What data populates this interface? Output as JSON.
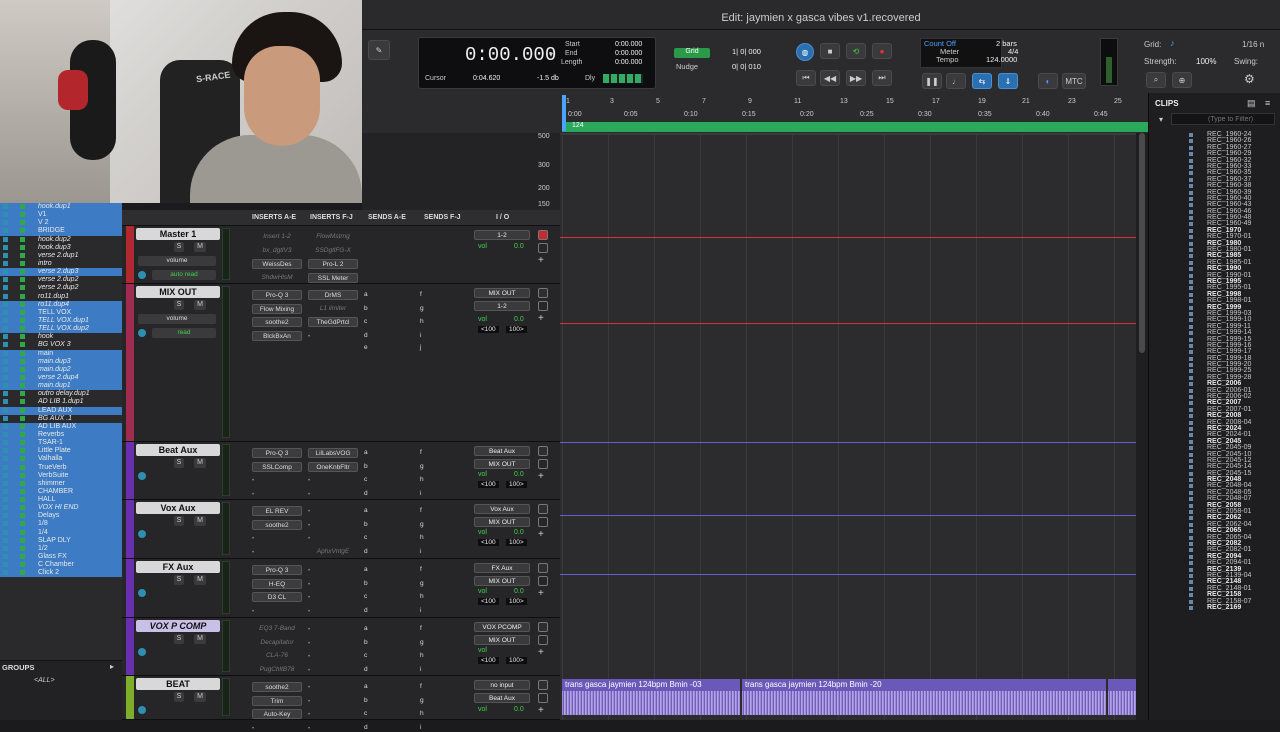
{
  "window": {
    "title": "Edit: jaymien x gasca vibes v1.recovered"
  },
  "webcam": {
    "chair_text": "S-RACE"
  },
  "transport": {
    "counter": "0:00.000",
    "start_label": "Start",
    "end_label": "End",
    "length_label": "Length",
    "start": "0:00.000",
    "end": "0:00.000",
    "length": "0:00.000",
    "cursor_label": "Cursor",
    "cursor": "0:04.620",
    "cursor_db": "-1.5 db",
    "dly_label": "Dly",
    "grid_label": "Grid",
    "grid_value": "1| 0| 000",
    "nudge_label": "Nudge",
    "nudge_value": "0| 0| 010",
    "count_off": "Count Off",
    "count_bars": "2 bars",
    "meter_label": "Meter",
    "meter_value": "4/4",
    "tempo_label": "Tempo",
    "tempo_value": "124.0000",
    "mtc": "MTC",
    "grid_right_label": "Grid:",
    "grid_right_value": "1/16 n",
    "strength_label": "Strength:",
    "strength_value": "100%",
    "swing_label": "Swing:"
  },
  "ruler": {
    "bars": [
      "1",
      "3",
      "5",
      "7",
      "9",
      "11",
      "13",
      "15",
      "17",
      "19",
      "21",
      "23",
      "25"
    ],
    "times": [
      "0:00",
      "0:05",
      "0:10",
      "0:15",
      "0:20",
      "0:25",
      "0:30",
      "0:35",
      "0:40",
      "0:45"
    ],
    "marker": "124",
    "tempo_scale": [
      "500",
      "300",
      "200",
      "150"
    ]
  },
  "clips": {
    "header": "CLIPS",
    "filter_placeholder": "(Type to Filter)",
    "items": [
      {
        "n": "REC_1960-24"
      },
      {
        "n": "REC_1960-26"
      },
      {
        "n": "REC_1960-27"
      },
      {
        "n": "REC_1960-29"
      },
      {
        "n": "REC_1960-32"
      },
      {
        "n": "REC_1960-33"
      },
      {
        "n": "REC_1960-35"
      },
      {
        "n": "REC_1960-37"
      },
      {
        "n": "REC_1960-38"
      },
      {
        "n": "REC_1960-39"
      },
      {
        "n": "REC_1960-40"
      },
      {
        "n": "REC_1960-43"
      },
      {
        "n": "REC_1960-46"
      },
      {
        "n": "REC_1960-48"
      },
      {
        "n": "REC_1960-49"
      },
      {
        "n": "REC_1970",
        "b": true
      },
      {
        "n": "REC_1970-01"
      },
      {
        "n": "REC_1980",
        "b": true
      },
      {
        "n": "REC_1980-01"
      },
      {
        "n": "REC_1985",
        "b": true
      },
      {
        "n": "REC_1985-01"
      },
      {
        "n": "REC_1990",
        "b": true
      },
      {
        "n": "REC_1990-01"
      },
      {
        "n": "REC_1995",
        "b": true
      },
      {
        "n": "REC_1995-01"
      },
      {
        "n": "REC_1998",
        "b": true
      },
      {
        "n": "REC_1998-01"
      },
      {
        "n": "REC_1999",
        "b": true
      },
      {
        "n": "REC_1999-03"
      },
      {
        "n": "REC_1999-10"
      },
      {
        "n": "REC_1999-11"
      },
      {
        "n": "REC_1999-14"
      },
      {
        "n": "REC_1999-15"
      },
      {
        "n": "REC_1999-16"
      },
      {
        "n": "REC_1999-17"
      },
      {
        "n": "REC_1999-18"
      },
      {
        "n": "REC_1999-20"
      },
      {
        "n": "REC_1999-25"
      },
      {
        "n": "REC_1999-28"
      },
      {
        "n": "REC_2006",
        "b": true
      },
      {
        "n": "REC_2006-01"
      },
      {
        "n": "REC_2006-02"
      },
      {
        "n": "REC_2007",
        "b": true
      },
      {
        "n": "REC_2007-01"
      },
      {
        "n": "REC_2008",
        "b": true
      },
      {
        "n": "REC_2008-04"
      },
      {
        "n": "REC_2024",
        "b": true
      },
      {
        "n": "REC_2024-01"
      },
      {
        "n": "REC_2045",
        "b": true
      },
      {
        "n": "REC_2045-09"
      },
      {
        "n": "REC_2045-10"
      },
      {
        "n": "REC_2045-12"
      },
      {
        "n": "REC_2045-14"
      },
      {
        "n": "REC_2045-15"
      },
      {
        "n": "REC_2048",
        "b": true
      },
      {
        "n": "REC_2048-04"
      },
      {
        "n": "REC_2048-05"
      },
      {
        "n": "REC_2048-07"
      },
      {
        "n": "REC_2058",
        "b": true
      },
      {
        "n": "REC_2058-01"
      },
      {
        "n": "REC_2062",
        "b": true
      },
      {
        "n": "REC_2062-04"
      },
      {
        "n": "REC_2065",
        "b": true
      },
      {
        "n": "REC_2065-04"
      },
      {
        "n": "REC_2082",
        "b": true
      },
      {
        "n": "REC_2082-01"
      },
      {
        "n": "REC_2094",
        "b": true
      },
      {
        "n": "REC_2094-01"
      },
      {
        "n": "REC_2139",
        "b": true
      },
      {
        "n": "REC_2139-04"
      },
      {
        "n": "REC_2148",
        "b": true
      },
      {
        "n": "REC_2148-01"
      },
      {
        "n": "REC_2158",
        "b": true
      },
      {
        "n": "REC_2158-07"
      },
      {
        "n": "REC_2169",
        "b": true
      }
    ]
  },
  "tracks": {
    "items": [
      {
        "n": "hook.dup1",
        "sel": true,
        "it": true
      },
      {
        "n": "V1",
        "sel": true
      },
      {
        "n": "V 2",
        "sel": true
      },
      {
        "n": "BRIDGE",
        "sel": true
      },
      {
        "n": "hook.dup2",
        "it": true
      },
      {
        "n": "hook.dup3",
        "it": true
      },
      {
        "n": "verse 2.dup1",
        "it": true
      },
      {
        "n": "intro",
        "it": true
      },
      {
        "n": "verse 2.dup3",
        "sel": true,
        "it": true
      },
      {
        "n": "verse 2.dup2",
        "it": true
      },
      {
        "n": "verse 2.dup2",
        "it": true
      },
      {
        "n": "ro11.dup1",
        "it": true
      },
      {
        "n": "ro11.dup4",
        "sel": true,
        "it": true
      },
      {
        "n": "TELL VOX",
        "sel": true
      },
      {
        "n": "TELL VOX.dup1",
        "sel": true,
        "it": true
      },
      {
        "n": "TELL VOX.dup2",
        "sel": true,
        "it": true
      },
      {
        "n": "hook",
        "it": true
      },
      {
        "n": "BG VOX 3",
        "it": true
      },
      {
        "n": "main",
        "sel": true
      },
      {
        "n": "main.dup3",
        "sel": true,
        "it": true
      },
      {
        "n": "main.dup2",
        "sel": true,
        "it": true
      },
      {
        "n": "verse 2.dup4",
        "sel": true,
        "it": true
      },
      {
        "n": "main.dup1",
        "sel": true,
        "it": true
      },
      {
        "n": "outro delay.dup1",
        "it": true
      },
      {
        "n": "AD LIB 1.dup1",
        "it": true
      },
      {
        "n": "LEAD AUX",
        "sel": true
      },
      {
        "n": "BG AUX .1",
        "it": true
      },
      {
        "n": "AD LIB AUX",
        "sel": true
      },
      {
        "n": "Reverbs",
        "sel": true
      },
      {
        "n": "TSAR-1",
        "sel": true
      },
      {
        "n": "Little Plate",
        "sel": true
      },
      {
        "n": "Valhalla",
        "sel": true
      },
      {
        "n": "TrueVerb",
        "sel": true
      },
      {
        "n": "VerbSuite",
        "sel": true
      },
      {
        "n": "shimmer",
        "sel": true
      },
      {
        "n": "CHAMBER",
        "sel": true
      },
      {
        "n": "HALL",
        "sel": true
      },
      {
        "n": "VOX HI END",
        "sel": true,
        "it": true
      },
      {
        "n": "Delays",
        "sel": true
      },
      {
        "n": "1/8",
        "sel": true
      },
      {
        "n": "1/4",
        "sel": true
      },
      {
        "n": "SLAP DLY",
        "sel": true
      },
      {
        "n": "1/2",
        "sel": true
      },
      {
        "n": "Glass FX",
        "sel": true
      },
      {
        "n": "C Chamber",
        "sel": true
      },
      {
        "n": "Click 2",
        "sel": true
      }
    ],
    "groups_label": "GROUPS",
    "groups_all": "<ALL>"
  },
  "mixer": {
    "headers": {
      "inserts_ae": "INSERTS A-E",
      "inserts_fj": "INSERTS F-J",
      "sends_ae": "SENDS A-E",
      "sends_fj": "SENDS F-J",
      "io": "I / O"
    },
    "strips": [
      {
        "name": "Master 1",
        "auto1": "volume",
        "auto2": "auto read",
        "a": [
          "Insert 1-2",
          "bx_dgtlV3",
          "WeissDes",
          "ShdwHlsM"
        ],
        "b": [
          "FlowMstrng",
          "SSDgtlFG-X",
          "Pro-L 2",
          "SSL Meter"
        ],
        "io1": "1-2",
        "io2": "",
        "vol": "vol",
        "vol_v": "0.0",
        "pan_l": "",
        "pan_r": "",
        "color": "#b02830"
      },
      {
        "name": "MIX OUT",
        "auto1": "volume",
        "auto2": "read",
        "a": [
          "Pro-Q 3",
          "Flow Mixing",
          "soothe2",
          "BlckBxAn"
        ],
        "b": [
          "DrMS",
          "L1 limiter",
          "TheGdPrtcl",
          ""
        ],
        "io1": "MIX OUT",
        "io2": "1-2",
        "vol": "vol",
        "vol_v": "0.0",
        "pan_l": "<100",
        "pan_r": "100>",
        "color": "#a02a50"
      },
      {
        "name": "Beat Aux",
        "auto1": "",
        "auto2": "",
        "a": [
          "Pro-Q 3",
          "SSLComp",
          "",
          ""
        ],
        "b": [
          "LilLabsVOG",
          "OneKnbFltr",
          "",
          ""
        ],
        "io1": "Beat Aux",
        "io2": "MIX OUT",
        "vol": "vol",
        "vol_v": "0.0",
        "pan_l": "<100",
        "pan_r": "100>",
        "color": "#6a2fb0"
      },
      {
        "name": "Vox Aux",
        "auto1": "",
        "auto2": "",
        "a": [
          "EL REV",
          "soothe2",
          "",
          ""
        ],
        "b": [
          "",
          "",
          "",
          "AphxVntgE"
        ],
        "io1": "Vox Aux",
        "io2": "MIX OUT",
        "vol": "vol",
        "vol_v": "0.0",
        "pan_l": "<100",
        "pan_r": "100>",
        "color": "#6a2fb0"
      },
      {
        "name": "FX Aux",
        "auto1": "",
        "auto2": "",
        "a": [
          "Pro-Q 3",
          "H-EQ",
          "D3 CL",
          ""
        ],
        "b": [
          "",
          "",
          "",
          ""
        ],
        "io1": "FX Aux",
        "io2": "MIX OUT",
        "vol": "vol",
        "vol_v": "0.0",
        "pan_l": "<100",
        "pan_r": "100>",
        "color": "#6a2fb0"
      },
      {
        "name": "VOX P COMP",
        "auto1": "",
        "auto2": "",
        "a": [
          "EQ3 7-Band",
          "Decapitator",
          "CLA-76",
          "PugChltB78"
        ],
        "b": [
          "",
          "",
          "",
          ""
        ],
        "io1": "VOX PCOMP",
        "io2": "MIX OUT",
        "vol": "vol",
        "vol_v": "",
        "pan_l": "<100",
        "pan_r": "100>",
        "color": "#6a2fb0"
      },
      {
        "name": "BEAT",
        "auto1": "",
        "auto2": "",
        "a": [
          "soothe2",
          "Trim",
          "Auto-Key",
          ""
        ],
        "b": [
          "",
          "",
          "",
          ""
        ],
        "io1": "no input",
        "io2": "Beat Aux",
        "vol": "vol",
        "vol_v": "0.0",
        "pan_l": "",
        "pan_r": "",
        "color": "#7fae2a"
      }
    ],
    "send_letters": [
      "a",
      "b",
      "c",
      "d",
      "e",
      "f",
      "g",
      "h",
      "i",
      "j"
    ]
  },
  "edit": {
    "clip1": "trans gasca jaymien 124bpm Bmin -03",
    "clip2": "trans gasca jaymien 124bpm Bmin -20",
    "clip3": "trans g"
  },
  "colors": {
    "accent": "#3d7cc4",
    "lcd_text": "#f0f0f0",
    "marker": "#2aa85c"
  }
}
